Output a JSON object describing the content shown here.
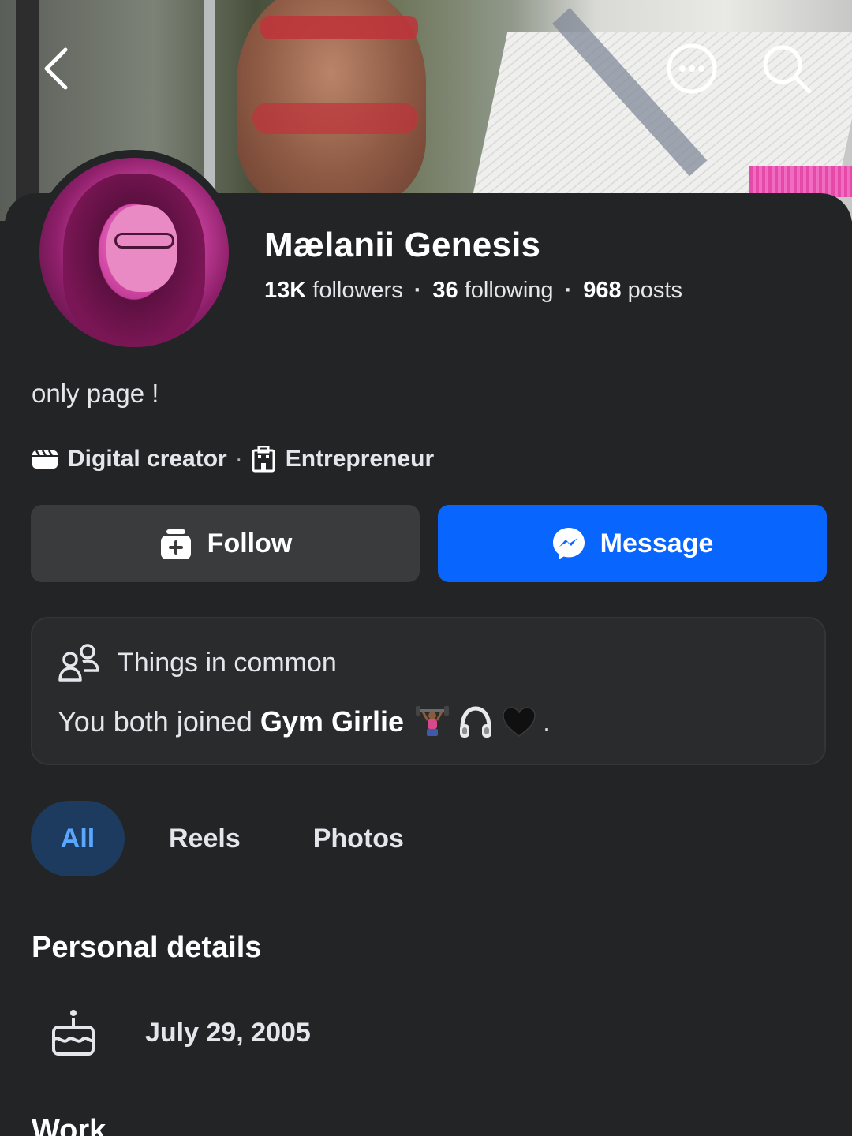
{
  "header": {
    "back_icon": "chevron-left-icon",
    "more_icon": "more-dots-icon",
    "search_icon": "search-icon"
  },
  "profile": {
    "name": "Mælanii Genesis",
    "followers_count": "13K",
    "followers_label": "followers",
    "following_count": "36",
    "following_label": "following",
    "posts_count": "968",
    "posts_label": "posts",
    "bio": "only page !",
    "categories": [
      {
        "label": "Digital creator",
        "icon": "clapperboard-icon"
      },
      {
        "label": "Entrepreneur",
        "icon": "building-icon"
      }
    ]
  },
  "actions": {
    "follow_label": "Follow",
    "message_label": "Message"
  },
  "common": {
    "title": "Things in common",
    "prefix": "You both joined",
    "group": "Gym Girlie",
    "suffix": "."
  },
  "tabs": [
    {
      "label": "All",
      "active": true
    },
    {
      "label": "Reels",
      "active": false
    },
    {
      "label": "Photos",
      "active": false
    }
  ],
  "personal_details": {
    "title": "Personal details",
    "birthday": "July 29, 2005"
  },
  "work": {
    "title": "Work"
  },
  "colors": {
    "background": "#232426",
    "primary_blue": "#0866ff",
    "active_tab_bg": "#1d3a5f",
    "active_tab_text": "#5aa7ff"
  }
}
